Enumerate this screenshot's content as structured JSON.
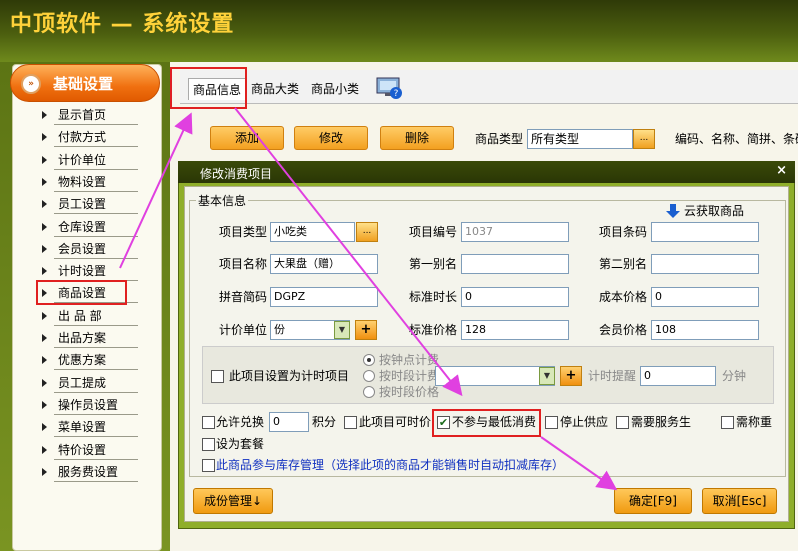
{
  "app": {
    "title": "中顶软件 — 系统设置"
  },
  "sidebar": {
    "header": "基础设置",
    "items": [
      {
        "label": "显示首页"
      },
      {
        "label": "付款方式"
      },
      {
        "label": "计价单位"
      },
      {
        "label": "物料设置"
      },
      {
        "label": "员工设置"
      },
      {
        "label": "仓库设置"
      },
      {
        "label": "会员设置"
      },
      {
        "label": "计时设置"
      },
      {
        "label": "商品设置"
      },
      {
        "label": "出 品 部"
      },
      {
        "label": "出品方案"
      },
      {
        "label": "优惠方案"
      },
      {
        "label": "员工提成"
      },
      {
        "label": "操作员设置"
      },
      {
        "label": "菜单设置"
      },
      {
        "label": "特价设置"
      },
      {
        "label": "服务费设置"
      }
    ]
  },
  "tabs": [
    {
      "label": "商品信息"
    },
    {
      "label": "商品大类"
    },
    {
      "label": "商品小类"
    }
  ],
  "toolbar": {
    "add": "添加",
    "edit": "修改",
    "delete": "删除",
    "category_label": "商品类型",
    "category_value": "所有类型",
    "dots": "...",
    "search_hint": "编码、名称、简拼、条码"
  },
  "dialog": {
    "title": "修改消费项目",
    "close": "×",
    "group": "基本信息",
    "cloud": "云获取商品",
    "fields": {
      "item_type_label": "项目类型",
      "item_type_value": "小吃类",
      "item_code_label": "项目编号",
      "item_code_value": "1037",
      "barcode_label": "项目条码",
      "barcode_value": "",
      "item_name_label": "项目名称",
      "item_name_value": "大果盘（赠）",
      "alias1_label": "第一别名",
      "alias1_value": "",
      "alias2_label": "第二别名",
      "alias2_value": "",
      "pinyin_label": "拼音简码",
      "pinyin_value": "DGPZ",
      "std_duration_label": "标准时长",
      "std_duration_value": "0",
      "cost_label": "成本价格",
      "cost_value": "0",
      "unit_label": "计价单位",
      "unit_value": "份",
      "std_price_label": "标准价格",
      "std_price_value": "128",
      "member_price_label": "会员价格",
      "member_price_value": "108"
    },
    "timing": {
      "checkbox_label": "此项目设置为计时项目",
      "radio1": "按钟点计费",
      "radio2": "按时段计费",
      "radio3": "按时段价格",
      "reminder_label": "计时提醒",
      "reminder_value": "0",
      "minutes": "分钟"
    },
    "options": {
      "exchange_label": "允许兑换",
      "exchange_value": "0",
      "points": "积分",
      "timed_price": "此项目可时价",
      "no_min_consume": "不参与最低消费",
      "stop_supply": "停止供应",
      "need_service": "需要服务生",
      "need_weigh": "需称重",
      "set_combo": "设为套餐",
      "inventory": "此商品参与库存管理（选择此项的商品才能销售时自动扣减库存）"
    },
    "buttons": {
      "component": "成份管理↓",
      "ok": "确定[F9]",
      "cancel": "取消[Esc]"
    }
  },
  "colors": {
    "accent_orange": "#f07010",
    "highlight_red": "#e02020",
    "arrow_magenta": "#e040e0"
  }
}
